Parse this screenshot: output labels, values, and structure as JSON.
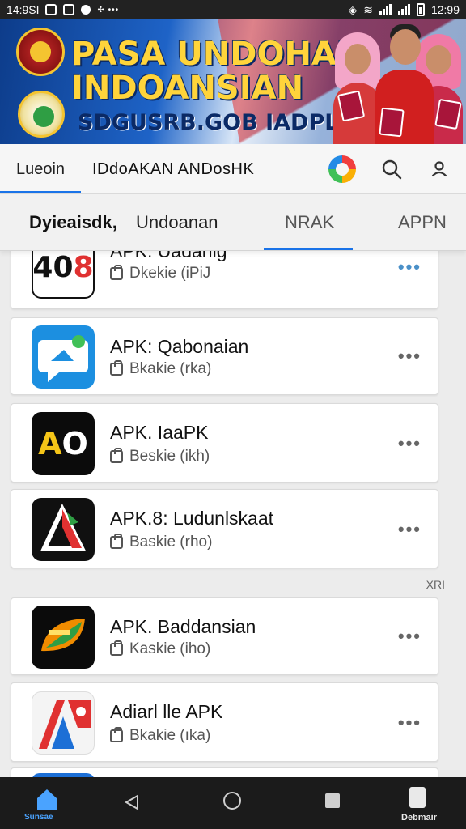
{
  "status_bar": {
    "time": "14:9SI",
    "right_time": "12:99"
  },
  "banner": {
    "title_line1": "PASA UNDOHAN",
    "title_line2": "INDOANSIAN",
    "subtitle": "SDGUSRB.GOB IADPL!"
  },
  "app_bar": {
    "tab_label": "Lueoin",
    "title": "IDdoAKAN ANDosHK",
    "icons": [
      "brand-logo",
      "search-icon",
      "person-icon"
    ]
  },
  "category_tabs": [
    {
      "label": "Dyieaisdk,"
    },
    {
      "label": "Undoanan"
    },
    {
      "label": "NRAK"
    },
    {
      "label": "APPN"
    }
  ],
  "apps": [
    {
      "name": "APK. Uadanig",
      "meta": "Dkekie (iPiJ",
      "icon_text_a": "40",
      "icon_text_b": "8"
    },
    {
      "name": "APK: Qabonaian",
      "meta": "Bkakie (rka)"
    },
    {
      "name": "APK. IaaPK",
      "meta": "Beskie (ikh)",
      "icon_text_a": "A",
      "icon_text_b": "O"
    },
    {
      "name": "APK.8: Ludunlskaat",
      "meta": "Baskie (rho)"
    },
    {
      "name": "APK. Baddansian",
      "meta": "Kaskie (iho)"
    },
    {
      "name": "Adiarl lle APK",
      "meta": "Bkakie (ıka)"
    }
  ],
  "section_label": "XRI",
  "more_symbol": "•••",
  "nav_bar": {
    "home_label": "Sunsae",
    "download_label": "Debmair"
  },
  "colors": {
    "accent": "#1a73e8",
    "banner_blue": "#1553ad",
    "banner_yellow": "#ffd43b",
    "nav_bg": "#1b1b1b"
  }
}
